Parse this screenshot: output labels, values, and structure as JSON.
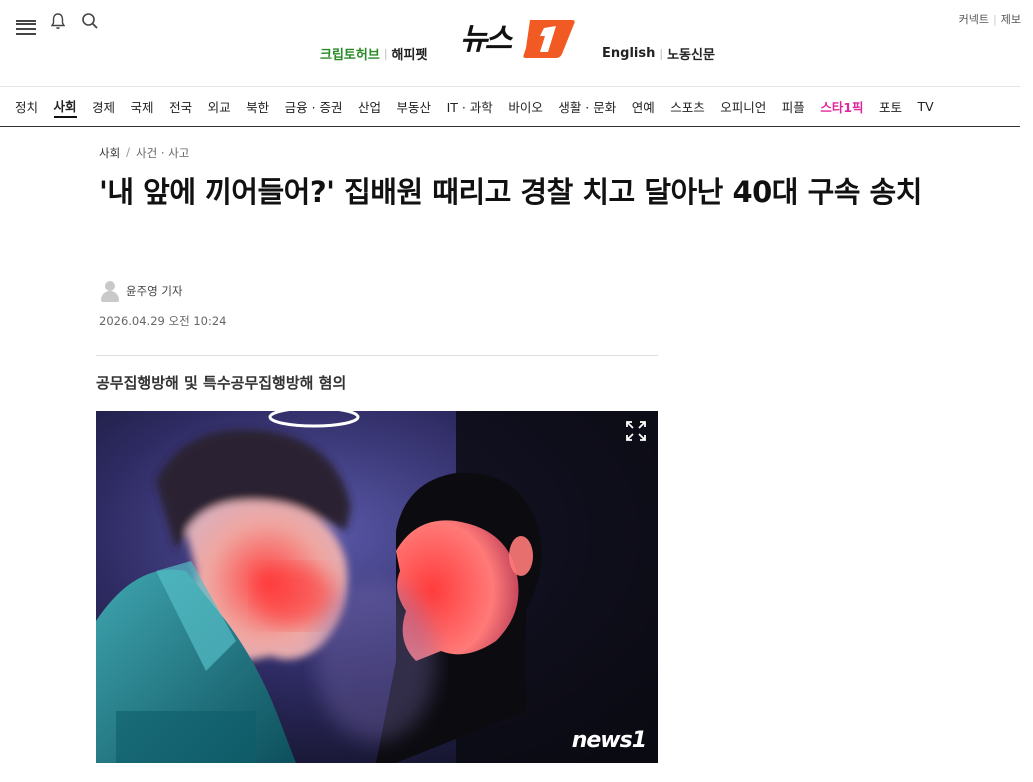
{
  "header": {
    "brand": "뉴스1",
    "links_left": [
      "크립토허브",
      "해피펫"
    ],
    "links_right": [
      "English",
      "노동신문"
    ],
    "util": [
      "커넥트",
      "제보"
    ]
  },
  "nav": {
    "items": [
      "정치",
      "사회",
      "경제",
      "국제",
      "전국",
      "외교",
      "북한",
      "금융 · 증권",
      "산업",
      "부동산",
      "IT · 과학",
      "바이오",
      "생활 · 문화",
      "연예",
      "스포츠",
      "오피니언",
      "피플",
      "스타1픽",
      "포토",
      "TV"
    ],
    "active": "사회"
  },
  "article": {
    "breadcrumb": [
      "사회",
      "사건 · 사고"
    ],
    "title": "'내 앞에 끼어들어?' 집배원 때리고 경찰 치고 달아난 40대 구속 송치",
    "author": "윤주영 기자",
    "date": "2026.04.29 오전 10:24",
    "subtitle": "공무집행방해 및 특수공무집행방해 혐의",
    "image_watermark": "news1"
  },
  "colors": {
    "brand_orange": "#f15a22",
    "green": "#2a8a28",
    "pink": "#e0289b"
  }
}
